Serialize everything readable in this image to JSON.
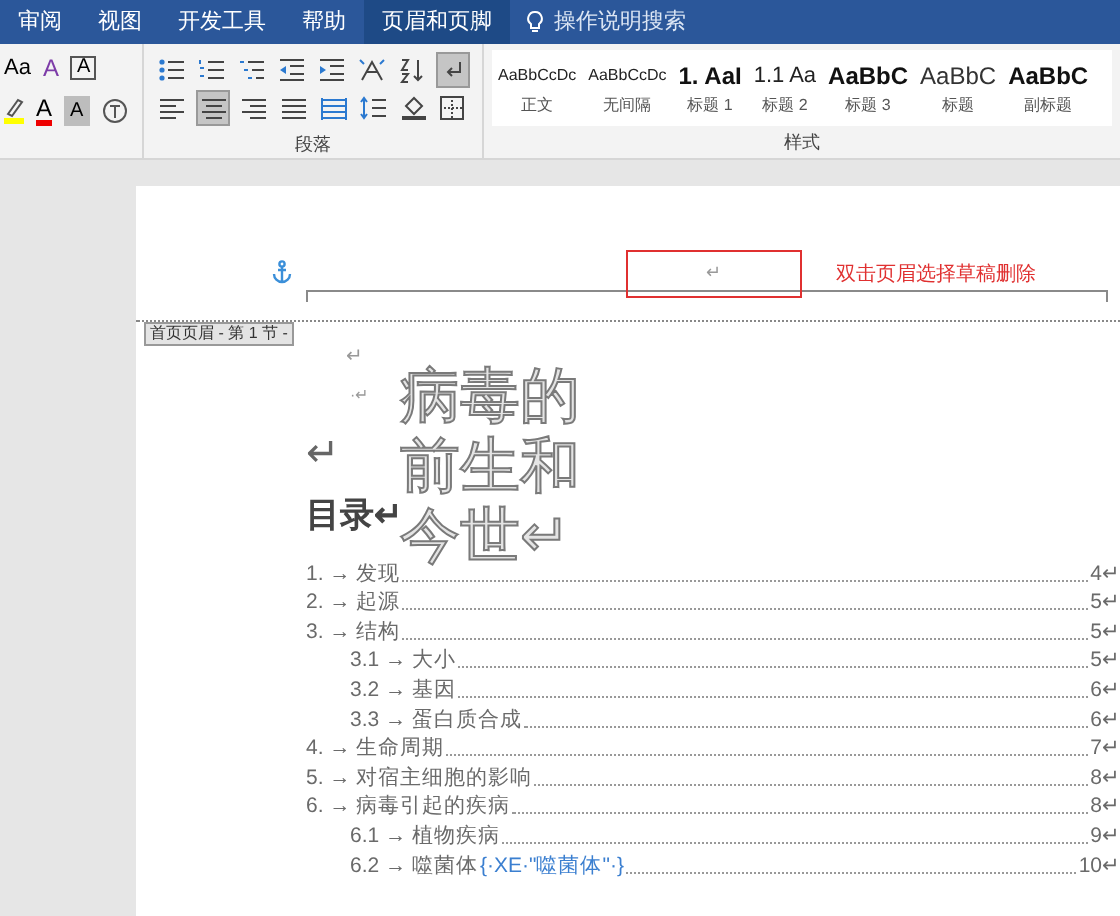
{
  "tabs": [
    {
      "label": "审阅",
      "selected": false
    },
    {
      "label": "视图",
      "selected": false
    },
    {
      "label": "开发工具",
      "selected": false
    },
    {
      "label": "帮助",
      "selected": false
    },
    {
      "label": "页眉和页脚",
      "selected": true
    }
  ],
  "search": {
    "placeholder": "操作说明搜索"
  },
  "font_group": {
    "row1": [
      "Aa",
      "A",
      "A"
    ],
    "row2": [
      "A",
      "A"
    ]
  },
  "paragraph_group": {
    "label": "段落",
    "row1": [
      {
        "kind": "bullets",
        "selected": false
      },
      {
        "kind": "numbering",
        "selected": false
      },
      {
        "kind": "multilevel",
        "selected": false
      },
      {
        "kind": "outdent",
        "selected": false
      },
      {
        "kind": "indent",
        "selected": false
      },
      {
        "kind": "asian",
        "selected": false
      },
      {
        "kind": "sort",
        "selected": false
      },
      {
        "kind": "marks",
        "selected": true
      }
    ],
    "row2": [
      {
        "kind": "left",
        "selected": false
      },
      {
        "kind": "center",
        "selected": true
      },
      {
        "kind": "right",
        "selected": false
      },
      {
        "kind": "justify",
        "selected": false
      },
      {
        "kind": "distributed",
        "selected": false
      },
      {
        "kind": "spacing",
        "selected": false
      },
      {
        "kind": "shading",
        "selected": false
      },
      {
        "kind": "borders",
        "selected": false
      }
    ]
  },
  "styles_group": {
    "label": "样式",
    "styles": [
      {
        "preview": "AaBbCcDc",
        "name": "正文",
        "kind": "small"
      },
      {
        "preview": "AaBbCcDc",
        "name": "无间隔",
        "kind": "small"
      },
      {
        "preview": "1. AaI",
        "name": "标题 1",
        "kind": "big"
      },
      {
        "preview": "1.1 Aa",
        "name": "标题 2",
        "kind": "medium"
      },
      {
        "preview": "AaBbC",
        "name": "标题 3",
        "kind": "big"
      },
      {
        "preview": "AaBbC",
        "name": "标题",
        "kind": "light"
      },
      {
        "preview": "AaBbC",
        "name": "副标题",
        "kind": "big"
      }
    ]
  },
  "header": {
    "mark": "↵",
    "annotation": "双击页眉选择草稿删除",
    "label": "首页页眉 - 第 1 节 -"
  },
  "body": {
    "marks": [
      "↵",
      "·↵",
      "↵"
    ],
    "title_lines": [
      "病毒的",
      "前生和",
      "今世↵"
    ],
    "toc_heading": "目录↵"
  },
  "toc": [
    {
      "number": "1. →",
      "title": "发现",
      "page": "4↵"
    },
    {
      "number": "2. →",
      "title": "起源",
      "page": "5↵"
    },
    {
      "number": "3. →",
      "title": "结构",
      "page": "5↵",
      "children": [
        {
          "number": "3.1 →",
          "title": "大小",
          "page": "5↵"
        },
        {
          "number": "3.2 →",
          "title": "基因",
          "page": "6↵"
        },
        {
          "number": "3.3 →",
          "title": "蛋白质合成",
          "page": "6↵"
        }
      ]
    },
    {
      "number": "4. →",
      "title": "生命周期",
      "page": "7↵"
    },
    {
      "number": "5. →",
      "title": "对宿主细胞的影响",
      "page": "8↵"
    },
    {
      "number": "6. →",
      "title": "病毒引起的疾病",
      "page": "8↵",
      "children": [
        {
          "number": "6.1 →",
          "title": "植物疾病",
          "page": "9↵"
        },
        {
          "number": "6.2 →",
          "title": "噬菌体",
          "field_code": "{·XE·\"噬菌体\"·}",
          "page": "10↵"
        }
      ]
    }
  ]
}
